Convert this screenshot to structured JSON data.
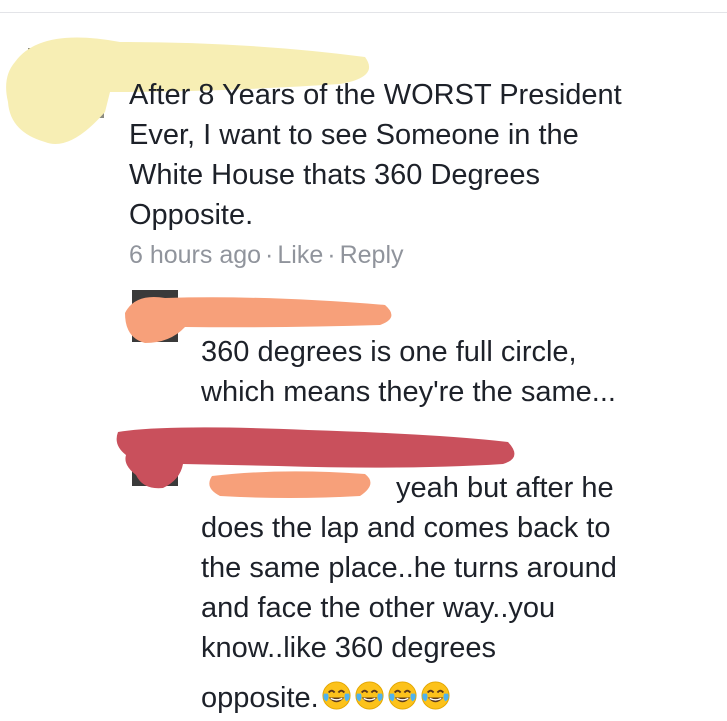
{
  "main_comment": {
    "text_lines": [
      "After 8 Years of the WORST President",
      "Ever, I want to see Someone in the",
      "White House thats 360 Degrees",
      "Opposite."
    ],
    "timestamp": "6 hours ago",
    "separator": "·",
    "like_label": "Like",
    "reply_label": "Reply"
  },
  "reply_1": {
    "text_lines": [
      "360 degrees is one full circle,",
      "which means they're the same..."
    ]
  },
  "reply_2": {
    "text_lines": [
      "yeah but after he",
      "does the lap and comes back to",
      "the same place..he turns around",
      "and face the other way..you",
      "know..like 360 degrees"
    ],
    "last_line": "opposite.",
    "emoji_count": 4,
    "emoji_icon": "face-with-tears-of-joy-icon"
  },
  "colors": {
    "text": "#1d2129",
    "meta": "#90949c",
    "redact_yellow": "#f7eeb4",
    "redact_orange": "#f7a07a",
    "redact_red": "#c9505c"
  }
}
